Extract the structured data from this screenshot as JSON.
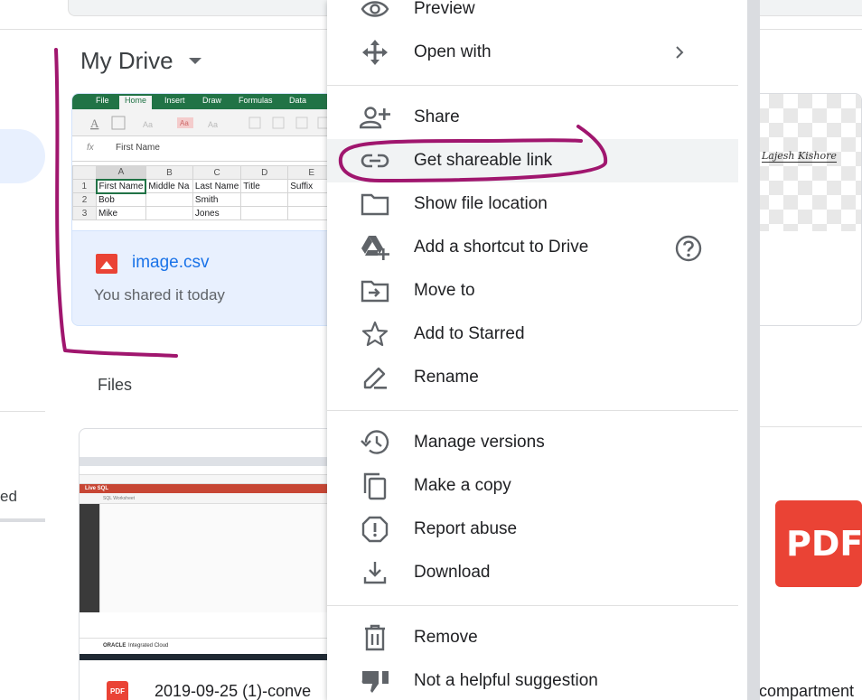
{
  "drive": {
    "title": "My Drive",
    "nav_partial_label": "ed",
    "files_label": "Files"
  },
  "suggested_cards": [
    {
      "name": "image.csv",
      "subtitle": "You shared it today",
      "thumbnail": {
        "ribbon_tabs": [
          "File",
          "Home",
          "Insert",
          "Draw",
          "Formulas",
          "Data"
        ],
        "formula_value": "First Name",
        "column_headers": [
          "",
          "A",
          "B",
          "C",
          "D",
          "E"
        ],
        "rows": [
          [
            "1",
            "First Name",
            "Middle Na",
            "Last Name",
            "Title",
            "Suffix"
          ],
          [
            "2",
            "Bob",
            "",
            "Smith",
            "",
            ""
          ],
          [
            "3",
            "Mike",
            "",
            "Jones",
            "",
            ""
          ]
        ]
      }
    },
    {
      "thumbnail_text": "Lajesh Kishore"
    }
  ],
  "file_cards": [
    {
      "name": "2019-09-25 (1)-conve",
      "type_badge": "PDF",
      "thumbnail": {
        "product": "Live SQL",
        "panel": "SQL Worksheet",
        "footer_brand": "ORACLE",
        "footer_product": "Integrated Cloud"
      }
    },
    {
      "name": "compartment",
      "type_badge": "PDF"
    }
  ],
  "context_menu": {
    "items": [
      {
        "label": "Preview",
        "icon": "eye-icon"
      },
      {
        "label": "Open with",
        "icon": "move-arrows-icon",
        "trailing": "chevron-right-icon"
      },
      {
        "label": "Share",
        "icon": "person-add-icon"
      },
      {
        "label": "Get shareable link",
        "icon": "link-icon",
        "highlighted": true
      },
      {
        "label": "Show file location",
        "icon": "folder-icon"
      },
      {
        "label": "Add a shortcut to Drive",
        "icon": "drive-shortcut-icon",
        "trailing": "help-icon"
      },
      {
        "label": "Move to",
        "icon": "move-to-folder-icon"
      },
      {
        "label": "Add to Starred",
        "icon": "star-icon"
      },
      {
        "label": "Rename",
        "icon": "pencil-icon"
      },
      {
        "label": "Manage versions",
        "icon": "history-icon"
      },
      {
        "label": "Make a copy",
        "icon": "copy-icon"
      },
      {
        "label": "Report abuse",
        "icon": "report-icon"
      },
      {
        "label": "Download",
        "icon": "download-icon"
      },
      {
        "label": "Remove",
        "icon": "trash-icon"
      },
      {
        "label": "Not a helpful suggestion",
        "icon": "thumbs-down-icon"
      }
    ]
  },
  "annotation_color": "#a0166e",
  "accent_color": "#1a73e8"
}
